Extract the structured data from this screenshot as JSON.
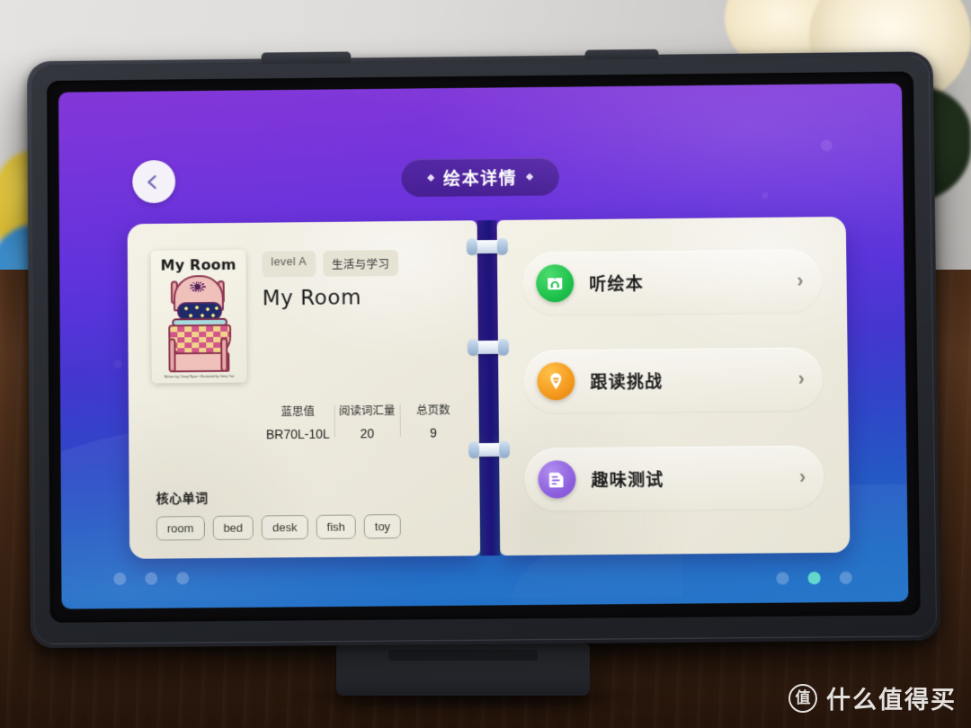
{
  "header": {
    "back_icon": "chevron-left-icon",
    "title": "绘本详情",
    "diamond_left": "◆",
    "diamond_right": "◆"
  },
  "book": {
    "cover": {
      "title": "My Room",
      "credit": "Written by Cheryl Ryan • Illustrated by Gerry Tan",
      "illustration": "pink-bed-illustration"
    },
    "level_tag": "level A",
    "category_tag": "生活与学习",
    "title": "My Room",
    "stats": [
      {
        "label": "蓝思值",
        "value": "BR70L-10L"
      },
      {
        "label": "阅读词汇量",
        "value": "20"
      },
      {
        "label": "总页数",
        "value": "9"
      }
    ],
    "core_words_heading": "核心单词",
    "core_words": [
      "room",
      "bed",
      "desk",
      "fish",
      "toy"
    ]
  },
  "actions": [
    {
      "label": "听绘本",
      "icon": "headphone-book-icon",
      "arrow": "›",
      "color": "#1fc24c"
    },
    {
      "label": "跟读挑战",
      "icon": "microphone-icon",
      "arrow": "›",
      "color": "#f49a1e"
    },
    {
      "label": "趣味测试",
      "icon": "quiz-paper-icon",
      "arrow": "›",
      "color": "#8f63df"
    }
  ],
  "status_dots": {
    "left": [
      "off",
      "off",
      "off"
    ],
    "right": [
      "off",
      "on",
      "off"
    ]
  },
  "watermark": {
    "logo_char": "值",
    "text": "什么值得买"
  },
  "theme": {
    "screen_top": "#8338d8",
    "screen_bottom": "#2374c9",
    "card_bg": "#f1eee2",
    "accent_green": "#1fc24c",
    "accent_orange": "#f49a1e",
    "accent_purple": "#8f63df"
  }
}
